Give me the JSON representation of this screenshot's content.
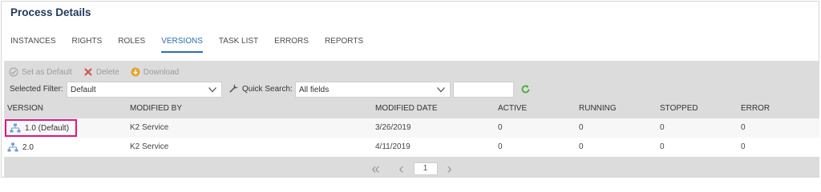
{
  "header": {
    "title": "Process Details"
  },
  "tabs": [
    {
      "label": "INSTANCES"
    },
    {
      "label": "RIGHTS"
    },
    {
      "label": "ROLES"
    },
    {
      "label": "VERSIONS",
      "active": true
    },
    {
      "label": "TASK LIST"
    },
    {
      "label": "ERRORS"
    },
    {
      "label": "REPORTS"
    }
  ],
  "toolbar": {
    "set_default": "Set as Default",
    "delete": "Delete",
    "download": "Download"
  },
  "filter": {
    "selected_label": "Selected Filter:",
    "selected_value": "Default",
    "quick_label": "Quick Search:",
    "quick_value": "All fields",
    "search_text": ""
  },
  "grid": {
    "columns": [
      "VERSION",
      "MODIFIED BY",
      "MODIFIED DATE",
      "ACTIVE",
      "RUNNING",
      "STOPPED",
      "ERROR"
    ],
    "rows": [
      {
        "version": "1.0 (Default)",
        "modified_by": "K2 Service",
        "modified_date": "3/26/2019",
        "active": "0",
        "running": "0",
        "stopped": "0",
        "error": "0"
      },
      {
        "version": "2.0",
        "modified_by": "K2 Service",
        "modified_date": "4/11/2019",
        "active": "0",
        "running": "0",
        "stopped": "0",
        "error": "0"
      }
    ]
  },
  "pager": {
    "page": "1"
  },
  "colors": {
    "accent": "#2a6fb0",
    "highlight": "#e2177c",
    "panel": "#dcdcdc",
    "delete": "#d9534f",
    "download": "#e6a22e",
    "refresh": "#4caa3c"
  }
}
